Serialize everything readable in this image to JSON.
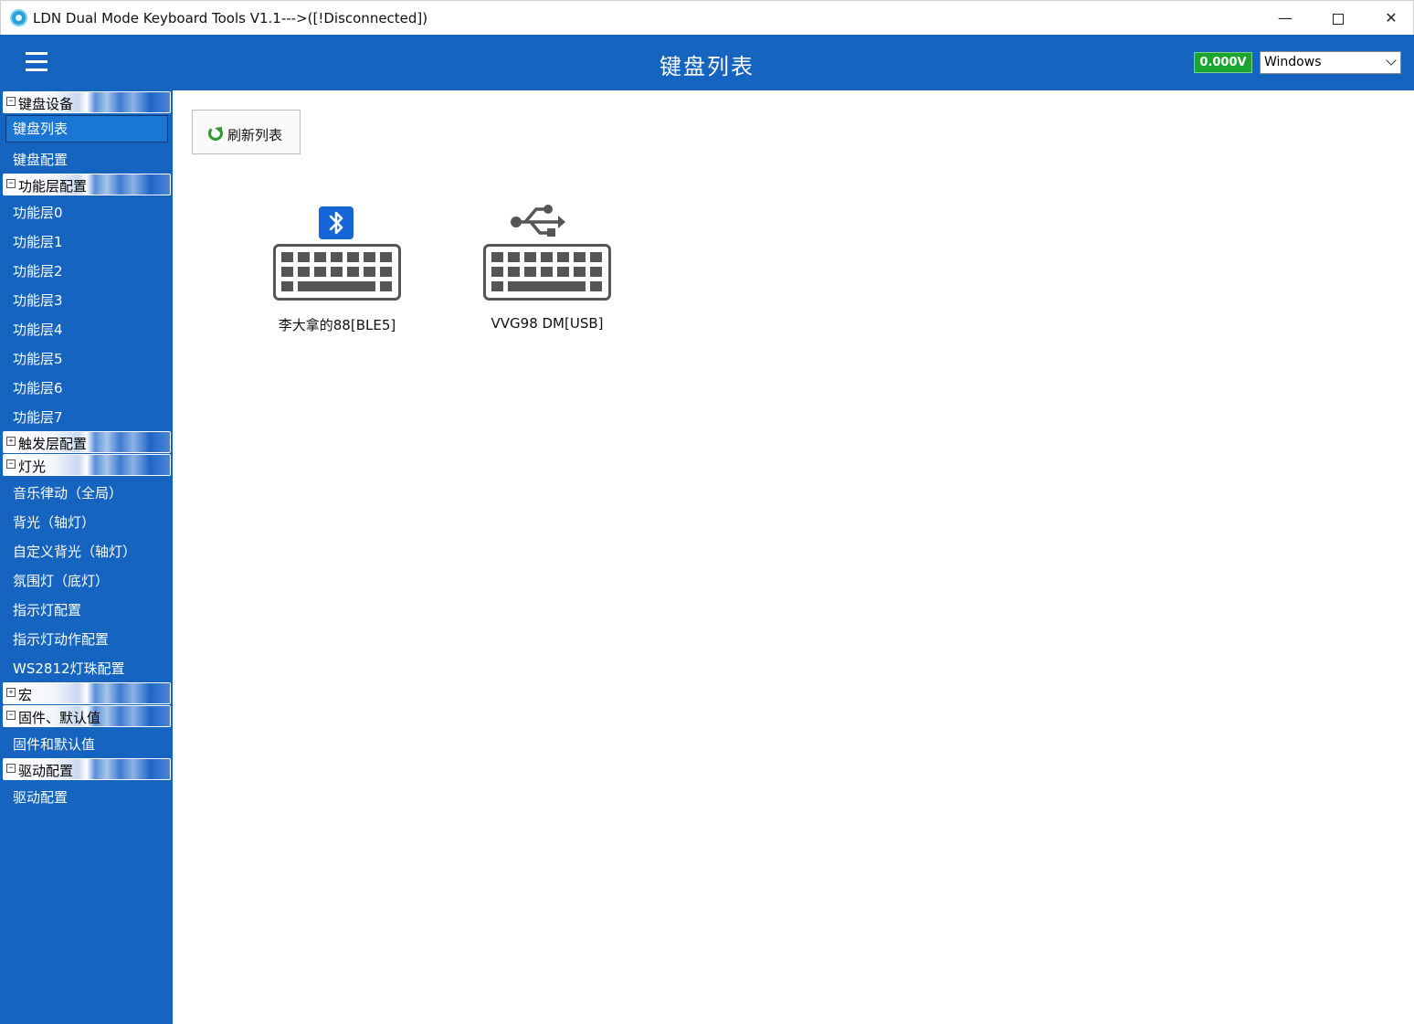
{
  "window": {
    "title": "LDN Dual Mode Keyboard Tools V1.1--->([!Disconnected])",
    "minimize": "—",
    "close": "✕"
  },
  "header": {
    "title": "键盘列表",
    "voltage": "0.000V",
    "os_selected": "Windows"
  },
  "sidebar": {
    "groups": {
      "keyboard_device": {
        "label": "键盘设备",
        "toggle": "−"
      },
      "layer_config": {
        "label": "功能层配置",
        "toggle": "−"
      },
      "trigger_config": {
        "label": "触发层配置",
        "toggle": "+"
      },
      "lighting": {
        "label": "灯光",
        "toggle": "−"
      },
      "macro": {
        "label": "宏",
        "toggle": "+"
      },
      "firmware": {
        "label": "固件、默认值",
        "toggle": "−"
      },
      "driver": {
        "label": "驱动配置",
        "toggle": "−"
      }
    },
    "items": {
      "keyboard_list": "键盘列表",
      "keyboard_config": "键盘配置",
      "layer0": "功能层0",
      "layer1": "功能层1",
      "layer2": "功能层2",
      "layer3": "功能层3",
      "layer4": "功能层4",
      "layer5": "功能层5",
      "layer6": "功能层6",
      "layer7": "功能层7",
      "music_rhythm": "音乐律动（全局）",
      "backlight": "背光（轴灯）",
      "custom_backlight": "自定义背光（轴灯）",
      "ambient_light": "氛围灯（底灯）",
      "indicator_config": "指示灯配置",
      "indicator_action": "指示灯动作配置",
      "ws2812": "WS2812灯珠配置",
      "firmware_defaults": "固件和默认值",
      "driver_config": "驱动配置"
    }
  },
  "main": {
    "refresh_label": "刷新列表",
    "devices": [
      {
        "name": "李大拿的88[BLE5]",
        "icon": "bluetooth-keyboard-icon"
      },
      {
        "name": "VVG98 DM[USB]",
        "icon": "usb-keyboard-icon"
      }
    ]
  },
  "colors": {
    "primary": "#1565c0",
    "voltage_bg": "#1aa530",
    "icon_gray": "#555555"
  }
}
